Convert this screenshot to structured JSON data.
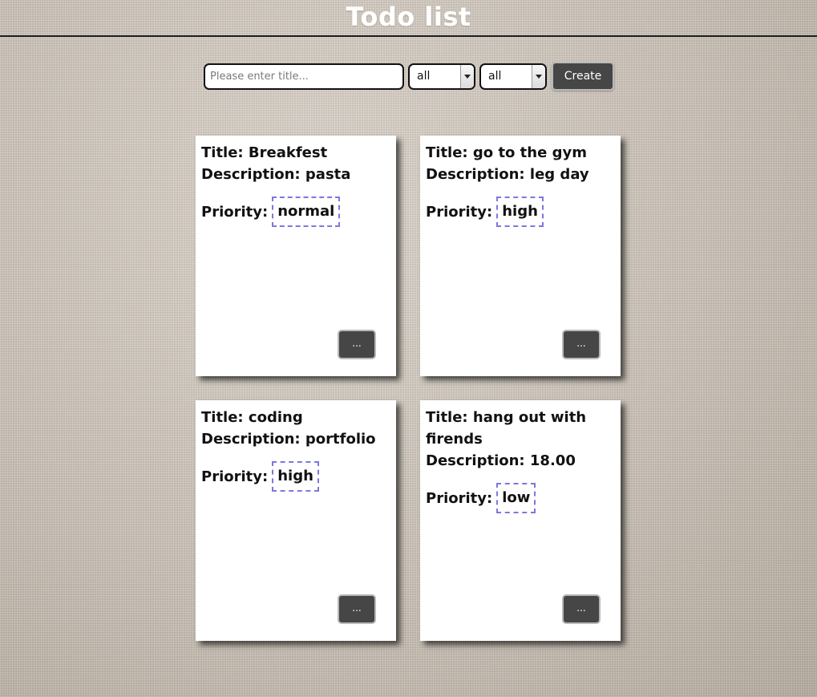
{
  "header": {
    "title": "Todo list"
  },
  "controls": {
    "title_input": {
      "value": "",
      "placeholder": "Please enter title..."
    },
    "filter_1": {
      "selected": "all"
    },
    "filter_2": {
      "selected": "all"
    },
    "create_label": "Create"
  },
  "todos": [
    {
      "title_label": "Title:",
      "title": "Breakfest",
      "description_label": "Description:",
      "description": "pasta",
      "priority_label": "Priority:",
      "priority": "normal",
      "menu_label": "..."
    },
    {
      "title_label": "Title:",
      "title": "go to the gym",
      "description_label": "Description:",
      "description": "leg day",
      "priority_label": "Priority:",
      "priority": "high",
      "menu_label": "..."
    },
    {
      "title_label": "Title:",
      "title": "coding",
      "description_label": "Description:",
      "description": "portfolio",
      "priority_label": "Priority:",
      "priority": "high",
      "menu_label": "..."
    },
    {
      "title_label": "Title:",
      "title": "hang out with firends",
      "description_label": "Description:",
      "description": "18.00",
      "priority_label": "Priority:",
      "priority": "low",
      "menu_label": "..."
    }
  ],
  "colors": {
    "background": "#cdc5bb",
    "card": "#ffffff",
    "button": "#464646",
    "priority_border": "#7b78e0"
  }
}
